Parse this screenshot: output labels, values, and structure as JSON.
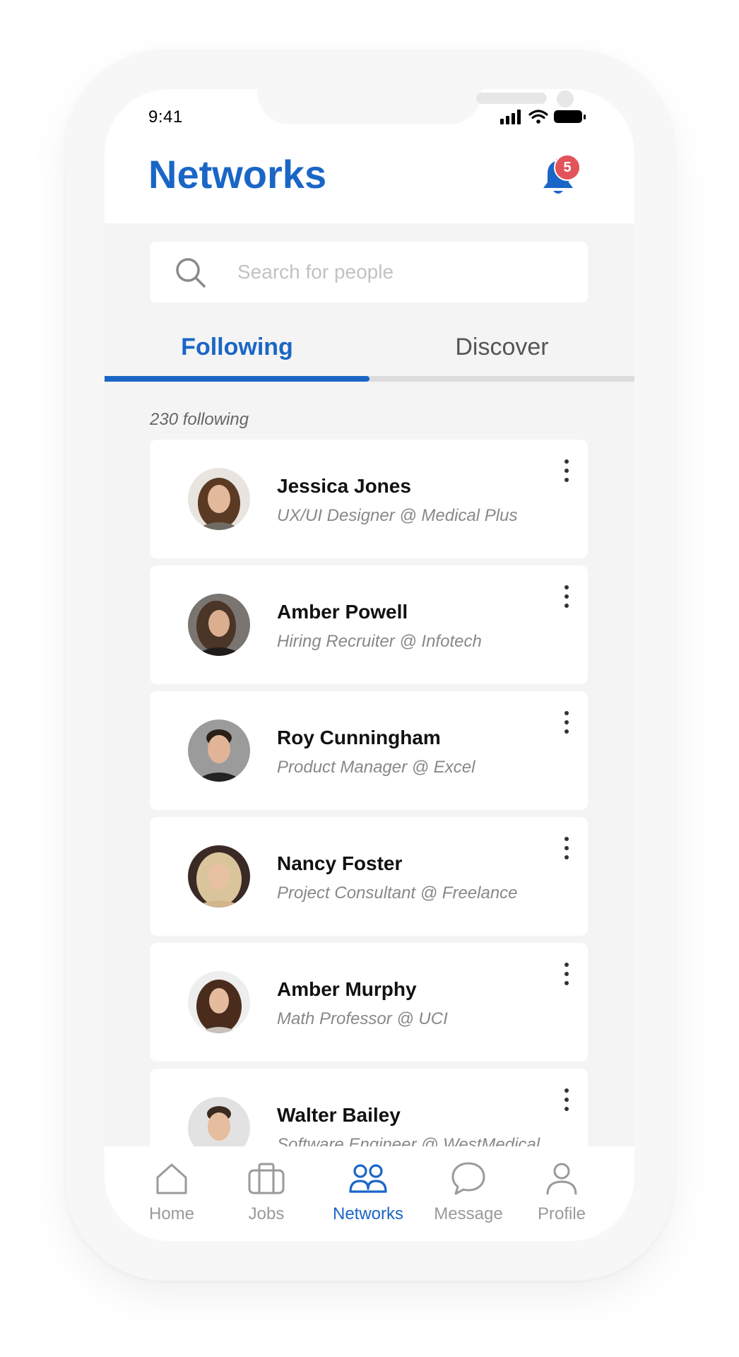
{
  "status_bar": {
    "time": "9:41"
  },
  "header": {
    "title": "Networks",
    "notification_count": "5"
  },
  "search": {
    "placeholder": "Search for people"
  },
  "tabs": [
    {
      "label": "Following",
      "active": true
    },
    {
      "label": "Discover",
      "active": false
    }
  ],
  "following_count_label": "230 following",
  "people": [
    {
      "name": "Jessica Jones",
      "role": "UX/UI Designer @ Medical Plus"
    },
    {
      "name": "Amber Powell",
      "role": "Hiring Recruiter @ Infotech"
    },
    {
      "name": "Roy Cunningham",
      "role": "Product Manager @ Excel"
    },
    {
      "name": "Nancy Foster",
      "role": "Project Consultant @ Freelance"
    },
    {
      "name": "Amber Murphy",
      "role": "Math Professor @ UCI"
    },
    {
      "name": "Walter Bailey",
      "role": "Software Engineer @ WestMedical"
    }
  ],
  "bottom_nav": [
    {
      "label": "Home",
      "icon": "home-icon"
    },
    {
      "label": "Jobs",
      "icon": "briefcase-icon"
    },
    {
      "label": "Networks",
      "icon": "people-icon",
      "active": true
    },
    {
      "label": "Message",
      "icon": "chat-bubble-icon"
    },
    {
      "label": "Profile",
      "icon": "user-icon"
    }
  ],
  "colors": {
    "accent": "#1a66c6",
    "badge": "#e2535a",
    "background": "#f4f4f4",
    "card": "#ffffff"
  }
}
